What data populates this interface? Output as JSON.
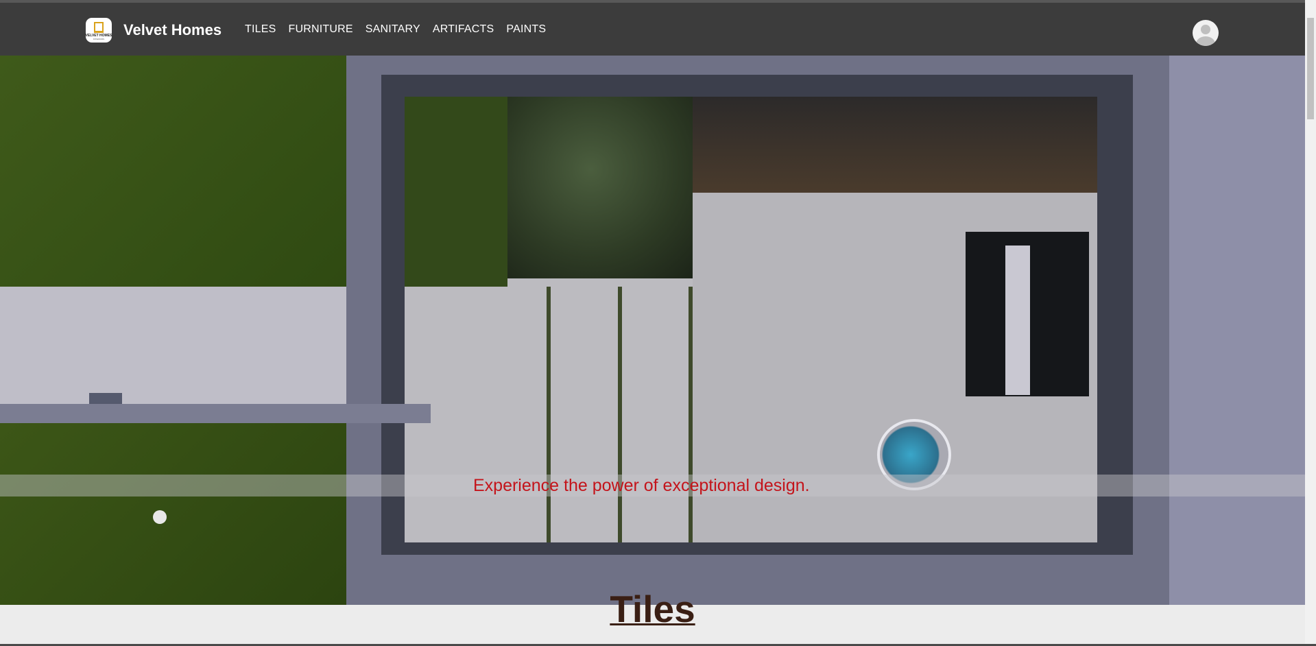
{
  "brand": {
    "name": "Velvet Homes",
    "logo_text": "VELVET HOMES",
    "logo_subtext": "INTERIORS"
  },
  "nav": {
    "items": [
      {
        "label": "TILES"
      },
      {
        "label": "FURNITURE"
      },
      {
        "label": "SANITARY"
      },
      {
        "label": "ARTIFACTS"
      },
      {
        "label": "PAINTS"
      }
    ]
  },
  "hero": {
    "tagline": "Experience the power of exceptional design."
  },
  "section": {
    "title": "Tiles"
  },
  "colors": {
    "navbar": "#3c3c3c",
    "tagline": "#c4141b",
    "section_title": "#3a1f14"
  },
  "icons": {
    "user": "user-avatar-icon"
  }
}
